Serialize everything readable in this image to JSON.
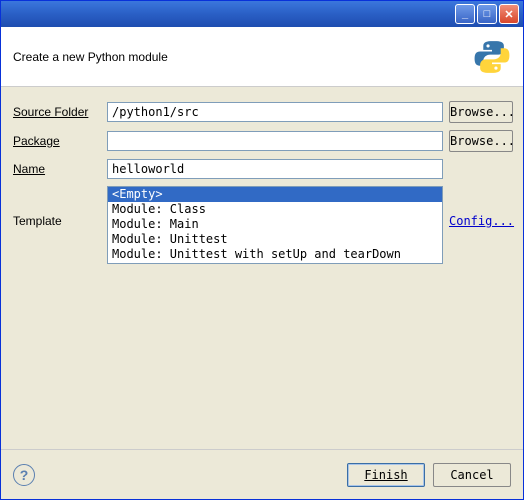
{
  "header": {
    "subtitle": "Create a new Python module"
  },
  "form": {
    "source_folder_label": "Source Folder",
    "source_folder_value": "/python1/src",
    "package_label": "Package",
    "package_value": "",
    "name_label": "Name",
    "name_value": "helloworld",
    "browse_label": "Browse...",
    "template_label": "Template",
    "config_label": "Config...",
    "templates": [
      "<Empty>",
      "Module: Class",
      "Module: Main",
      "Module: Unittest",
      "Module: Unittest with setUp and tearDown"
    ],
    "selected_template_index": 0
  },
  "footer": {
    "finish_label": "Finish",
    "cancel_label": "Cancel"
  }
}
